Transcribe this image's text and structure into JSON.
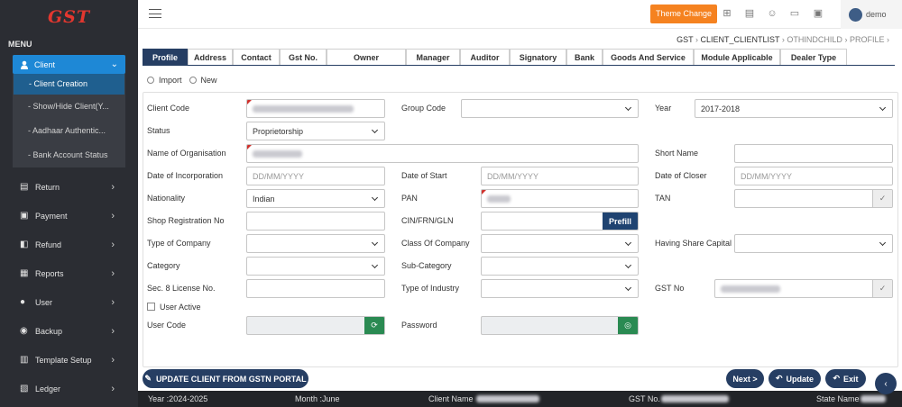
{
  "app": {
    "logo_text": "GST"
  },
  "sidebar": {
    "menu_heading": "MENU",
    "client": {
      "label": "Client",
      "icon": "user-icon"
    },
    "client_subitems": [
      {
        "label": "- Client Creation",
        "active": true
      },
      {
        "label": "- Show/Hide Client(Y..."
      },
      {
        "label": "- Aadhaar Authentic..."
      },
      {
        "label": "- Bank Account Status"
      }
    ],
    "items": [
      {
        "label": "Return",
        "icon": "document-icon"
      },
      {
        "label": "Payment",
        "icon": "payment-icon"
      },
      {
        "label": "Refund",
        "icon": "refund-icon"
      },
      {
        "label": "Reports",
        "icon": "reports-icon"
      },
      {
        "label": "User",
        "icon": "user-icon"
      },
      {
        "label": "Backup",
        "icon": "database-icon"
      },
      {
        "label": "Template Setup",
        "icon": "template-icon"
      },
      {
        "label": "Ledger",
        "icon": "ledger-icon"
      }
    ]
  },
  "header": {
    "theme_button": "Theme Change",
    "user_name": "demo"
  },
  "breadcrumb": {
    "items": [
      "GST",
      "CLIENT_CLIENTLIST",
      "OTHINDCHILD",
      "PROFILE"
    ]
  },
  "tabs": [
    "Profile",
    "Address",
    "Contact",
    "Gst No.",
    "Owner",
    "Manager",
    "Auditor",
    "Signatory",
    "Bank",
    "Goods And Service",
    "Module Applicable",
    "Dealer Type"
  ],
  "mode": {
    "import": "Import",
    "new": "New"
  },
  "form": {
    "client_code": {
      "label": "Client Code"
    },
    "group_code": {
      "label": "Group Code"
    },
    "year": {
      "label": "Year",
      "value": "2017-2018"
    },
    "status": {
      "label": "Status",
      "value": "Proprietorship"
    },
    "name_of_organisation": {
      "label": "Name of Organisation"
    },
    "short_name": {
      "label": "Short Name"
    },
    "date_of_incorporation": {
      "label": "Date of Incorporation",
      "placeholder": "DD/MM/YYYY"
    },
    "date_of_start": {
      "label": "Date of Start",
      "placeholder": "DD/MM/YYYY"
    },
    "date_of_closer": {
      "label": "Date of Closer",
      "placeholder": "DD/MM/YYYY"
    },
    "nationality": {
      "label": "Nationality",
      "value": "Indian"
    },
    "pan": {
      "label": "PAN"
    },
    "tan": {
      "label": "TAN"
    },
    "shop_registration_no": {
      "label": "Shop Registration No"
    },
    "cin": {
      "label": "CIN/FRN/GLN",
      "button": "Prefill"
    },
    "type_of_company": {
      "label": "Type of Company"
    },
    "class_of_company": {
      "label": "Class Of Company"
    },
    "having_share_capital": {
      "label": "Having Share Capital"
    },
    "category": {
      "label": "Category"
    },
    "sub_category": {
      "label": "Sub-Category"
    },
    "sec8_license": {
      "label": "Sec. 8 License No."
    },
    "type_of_industry": {
      "label": "Type of Industry"
    },
    "gst_no": {
      "label": "GST No"
    },
    "user_active": {
      "label": "User Active"
    },
    "user_code": {
      "label": "User Code"
    },
    "password": {
      "label": "Password"
    }
  },
  "actions": {
    "update_gstn": "UPDATE CLIENT FROM GSTN PORTAL",
    "next": "Next >",
    "update": "Update",
    "exit": "Exit"
  },
  "footer": {
    "year": "Year :2024-2025",
    "month": "Month :June",
    "client_name_label": "Client Name",
    "gst_no_label": "GST No.",
    "state_name_label": "State Name"
  },
  "colors": {
    "accent": "#263e63",
    "theme_button": "#f58220",
    "sidebar": "#2b2d33",
    "active_menu": "#1e88d6",
    "green": "#2a8a52"
  }
}
